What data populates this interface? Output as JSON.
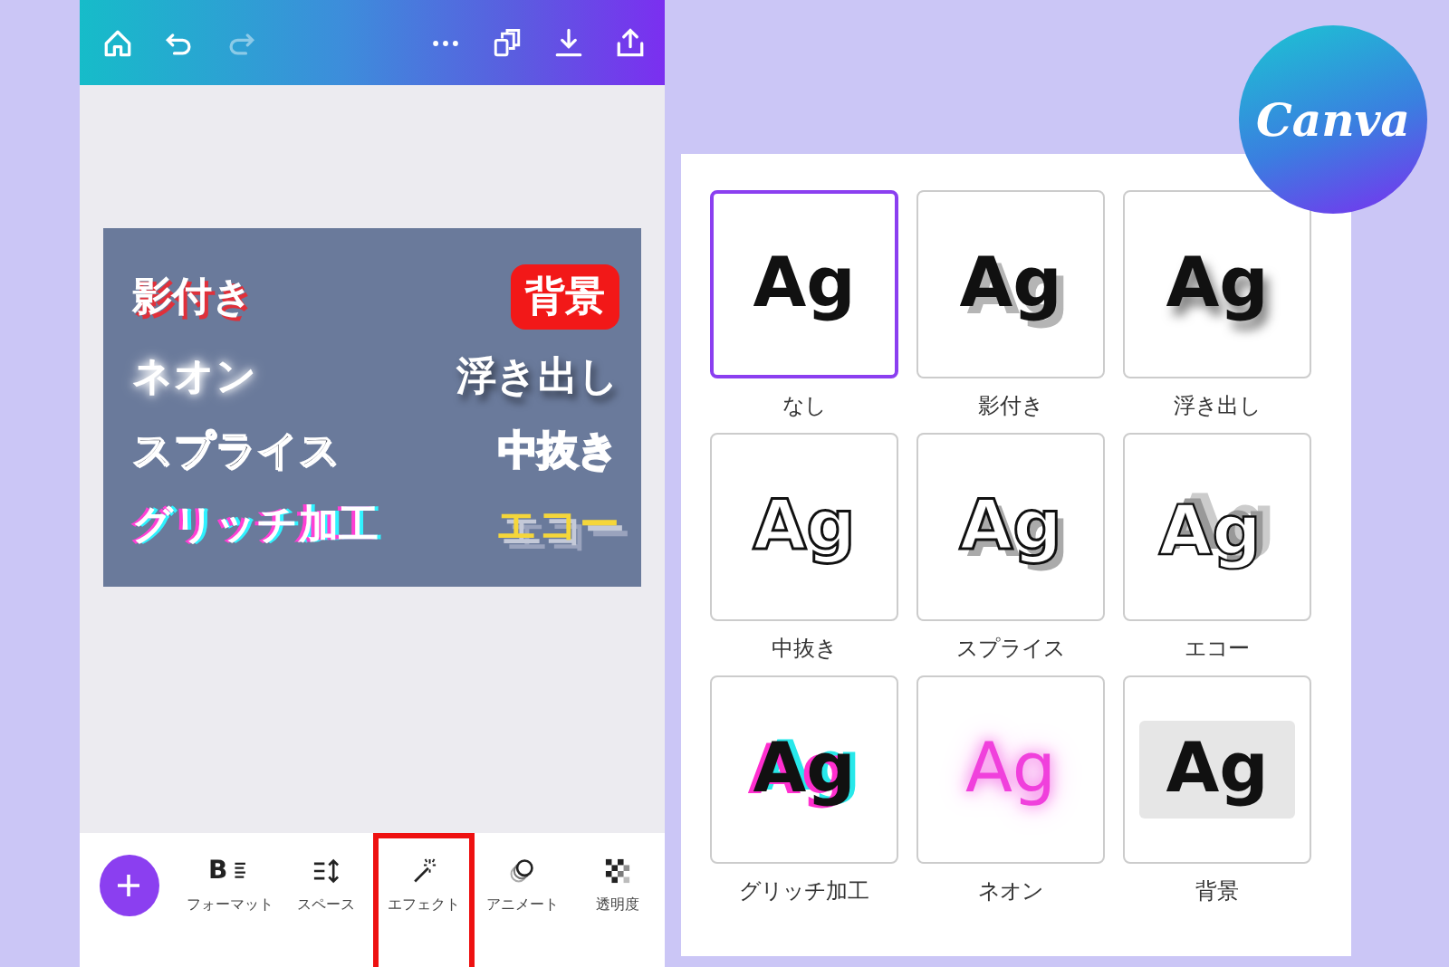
{
  "design_card": {
    "texts": [
      {
        "text": "影付き",
        "kind": "shadow"
      },
      {
        "text": "背景",
        "kind": "background"
      },
      {
        "text": "ネオン",
        "kind": "neon"
      },
      {
        "text": "浮き出し",
        "kind": "lift"
      },
      {
        "text": "スプライス",
        "kind": "splice"
      },
      {
        "text": "中抜き",
        "kind": "hollow"
      },
      {
        "text": "グリッチ加工",
        "kind": "glitch"
      },
      {
        "text": "エコー",
        "kind": "echo"
      }
    ]
  },
  "toolbar": {
    "tools": [
      {
        "label": "フォーマット",
        "kind": "format",
        "glyph": "B",
        "selected": false
      },
      {
        "label": "スペース",
        "kind": "spacing",
        "selected": false
      },
      {
        "label": "エフェクト",
        "kind": "effects",
        "selected": true
      },
      {
        "label": "アニメート",
        "kind": "animate",
        "selected": false
      },
      {
        "label": "透明度",
        "kind": "transparency",
        "selected": false
      }
    ]
  },
  "effects_panel": {
    "effects": [
      {
        "label": "なし",
        "sample": "Ag",
        "kind": "none",
        "selected": true
      },
      {
        "label": "影付き",
        "sample": "Ag",
        "kind": "shadow",
        "selected": false
      },
      {
        "label": "浮き出し",
        "sample": "Ag",
        "kind": "lift",
        "selected": false
      },
      {
        "label": "中抜き",
        "sample": "Ag",
        "kind": "hollow",
        "selected": false
      },
      {
        "label": "スプライス",
        "sample": "Ag",
        "kind": "splice",
        "selected": false
      },
      {
        "label": "エコー",
        "sample": "Ag",
        "kind": "echo",
        "selected": false
      },
      {
        "label": "グリッチ加工",
        "sample": "Ag",
        "kind": "glitch",
        "selected": false
      },
      {
        "label": "ネオン",
        "sample": "Ag",
        "kind": "neon",
        "selected": false
      },
      {
        "label": "背景",
        "sample": "Ag",
        "kind": "background",
        "selected": false
      }
    ]
  },
  "logo": {
    "text": "Canva"
  }
}
